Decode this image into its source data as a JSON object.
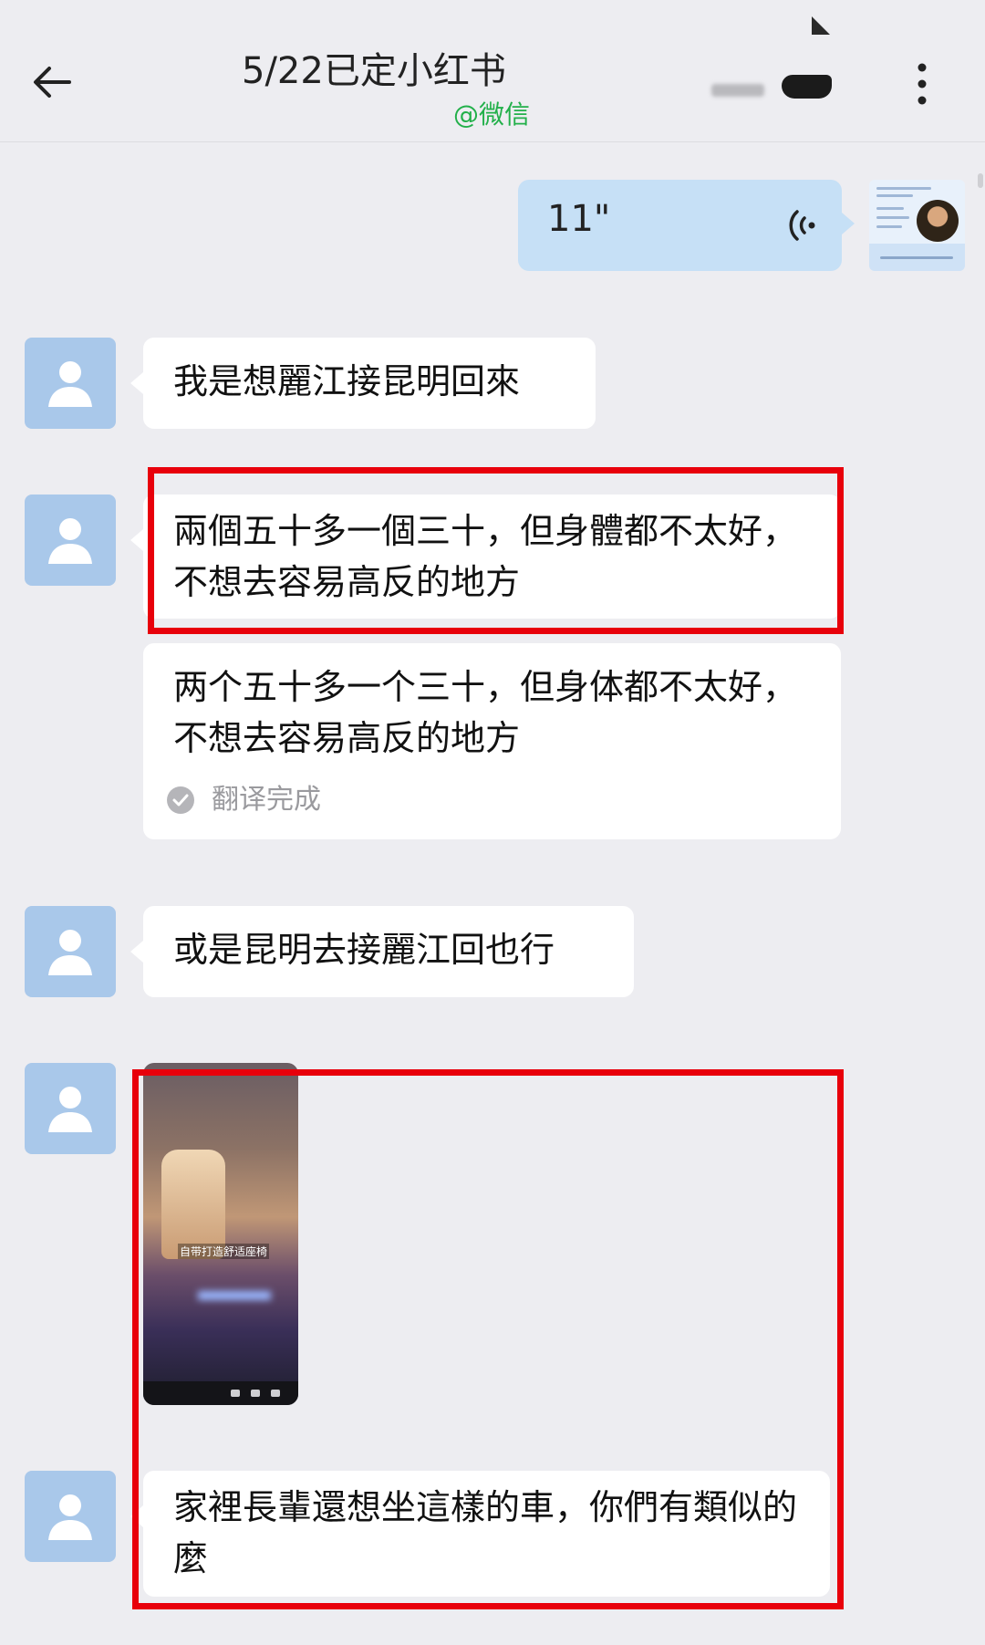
{
  "header": {
    "title": "5/22已定小红书",
    "subtitle": "@微信"
  },
  "voice_message": {
    "duration": "11\""
  },
  "messages": [
    {
      "text": "我是想麗江接昆明回來"
    },
    {
      "text": "兩個五十多一個三十，但身體都不太好，不想去容易高反的地方"
    },
    {
      "text": "两个五十多一个三十，但身体都不太好，不想去容易高反的地方",
      "status": "翻译完成"
    },
    {
      "text": "或是昆明去接麗江回也行"
    },
    {
      "video_caption": "自带打造舒适座椅"
    },
    {
      "text": "家裡長輩還想坐這樣的車，你們有類似的麼"
    }
  ],
  "colors": {
    "highlight_box": "#e8000b",
    "voice_bubble": "#c6e0f6",
    "avatar": "#a9c8ea",
    "subtitle": "#22b04a"
  }
}
